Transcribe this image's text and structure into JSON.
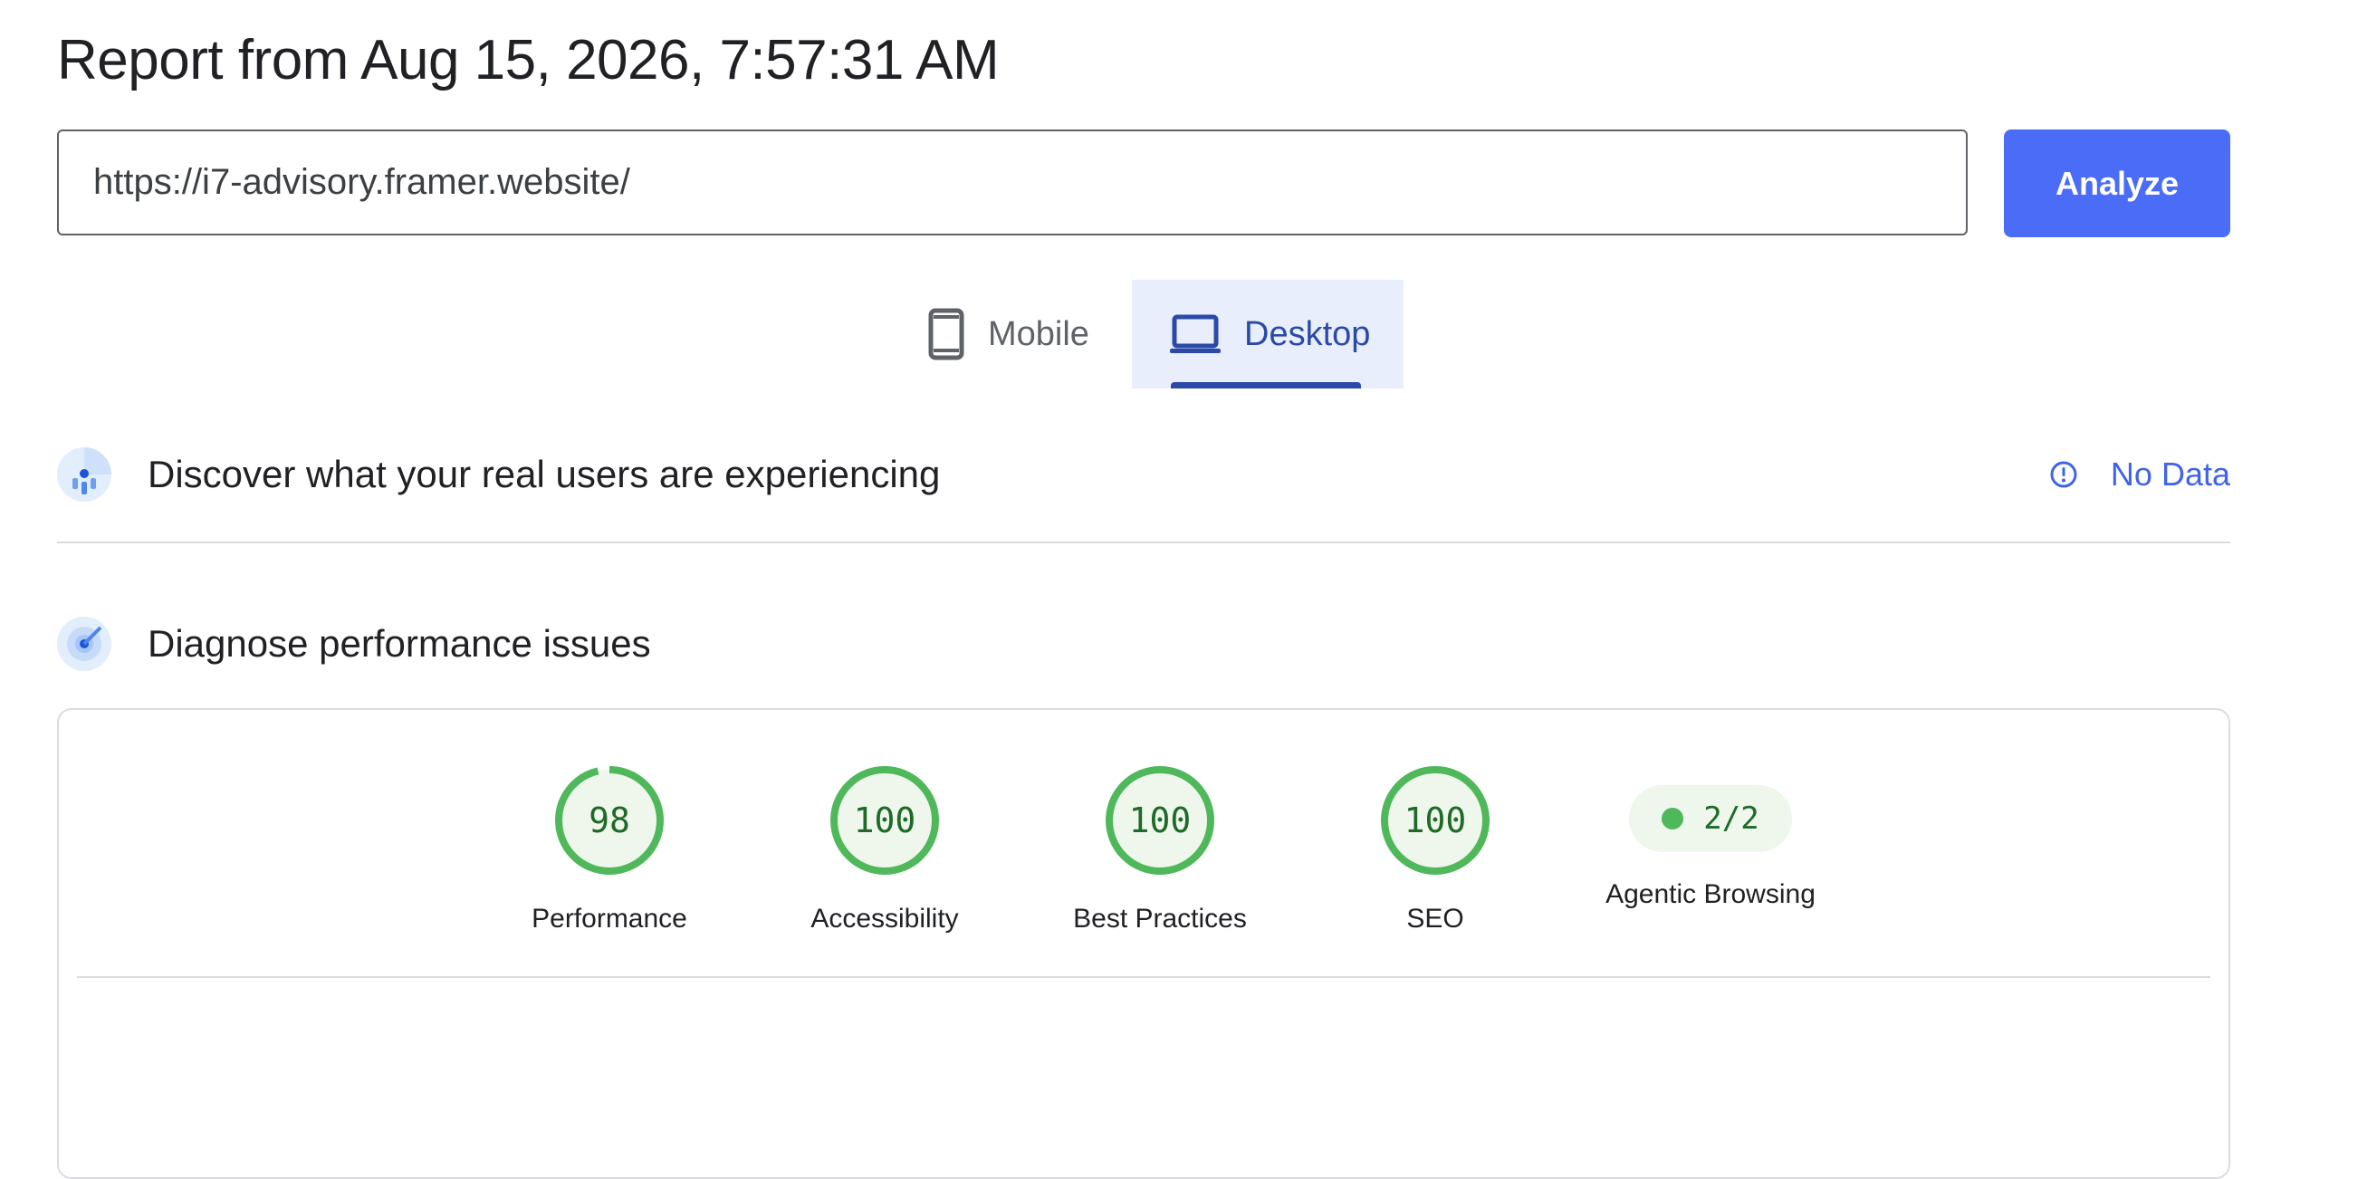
{
  "report": {
    "title": "Report from Aug 15, 2026, 7:57:31 AM"
  },
  "url_bar": {
    "value": "https://i7-advisory.framer.website/",
    "analyze_label": "Analyze"
  },
  "device_tabs": {
    "mobile_label": "Mobile",
    "desktop_label": "Desktop",
    "selected": "Desktop"
  },
  "crux": {
    "title": "Discover what your real users are experiencing",
    "status": "No Data"
  },
  "diagnose": {
    "title": "Diagnose performance issues"
  },
  "scores": [
    {
      "label": "Performance",
      "value": "98",
      "fraction": 0.98
    },
    {
      "label": "Accessibility",
      "value": "100",
      "fraction": 1.0
    },
    {
      "label": "Best Practices",
      "value": "100",
      "fraction": 1.0
    },
    {
      "label": "SEO",
      "value": "100",
      "fraction": 1.0
    }
  ],
  "agentic": {
    "label": "Agentic Browsing",
    "value": "2/2"
  },
  "colors": {
    "accent": "#4a6cf7",
    "pass": "#4fb85a",
    "pass_text": "#1e6a27",
    "pass_bg": "#eff6ec"
  }
}
